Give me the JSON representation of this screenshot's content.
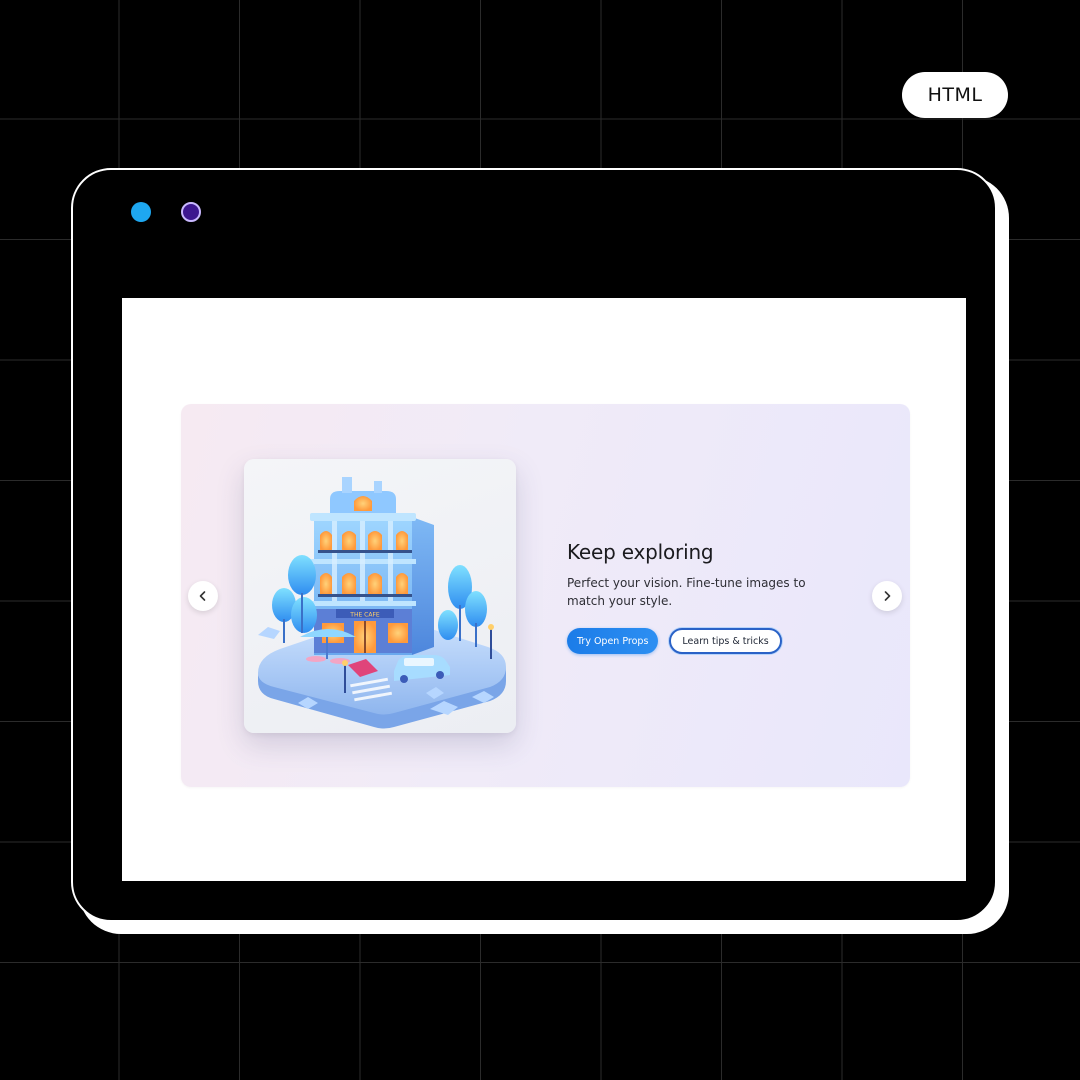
{
  "badge": {
    "label": "HTML"
  },
  "window": {
    "dots": [
      {
        "color": "#1ea7f0"
      },
      {
        "color": "#3d178f"
      }
    ]
  },
  "carousel": {
    "prev_icon": "chevron-left-icon",
    "next_icon": "chevron-right-icon",
    "image": {
      "icon": "isometric-building-illustration",
      "sign_text": "THE CAFE"
    },
    "title": "Keep exploring",
    "description": "Perfect your vision. Fine-tune images to match your style.",
    "primary_button": "Try Open Props",
    "secondary_button": "Learn tips & tricks"
  },
  "colors": {
    "accent": "#1b7ce8",
    "outline": "#2a62c7",
    "background": "#000000"
  }
}
